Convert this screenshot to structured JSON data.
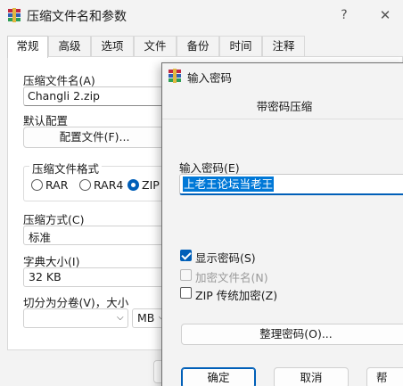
{
  "main": {
    "title": "压缩文件名和参数",
    "help": "?",
    "close": "✕",
    "tabs": [
      {
        "label": "常规",
        "active": true
      },
      {
        "label": "高级"
      },
      {
        "label": "选项"
      },
      {
        "label": "文件"
      },
      {
        "label": "备份"
      },
      {
        "label": "时间"
      },
      {
        "label": "注释"
      }
    ],
    "archive_name_label": "压缩文件名(A)",
    "archive_name_value": "Changli 2.zip",
    "default_profile_label": "默认配置",
    "profiles_button": "配置文件(F)...",
    "format_group_label": "压缩文件格式",
    "formats": [
      {
        "label": "RAR",
        "checked": false
      },
      {
        "label": "RAR4",
        "checked": false
      },
      {
        "label": "ZIP",
        "checked": true
      }
    ],
    "method_label": "压缩方式(C)",
    "method_value": "标准",
    "dict_label": "字典大小(I)",
    "dict_value": "32 KB",
    "split_label": "切分为分卷(V)，大小",
    "split_value": "",
    "split_unit": "MB"
  },
  "password_dialog": {
    "title": "输入密码",
    "subtitle": "带密码压缩",
    "field_label": "输入密码(E)",
    "field_value": "上老王论坛当老王",
    "options": [
      {
        "label": "显示密码(S)",
        "checked": true,
        "enabled": true
      },
      {
        "label": "加密文件名(N)",
        "checked": false,
        "enabled": false
      },
      {
        "label": "ZIP 传统加密(Z)",
        "checked": false,
        "enabled": true
      }
    ],
    "organize_button": "整理密码(O)...",
    "ok_button": "确定",
    "cancel_button": "取消",
    "help_button": "帮"
  }
}
